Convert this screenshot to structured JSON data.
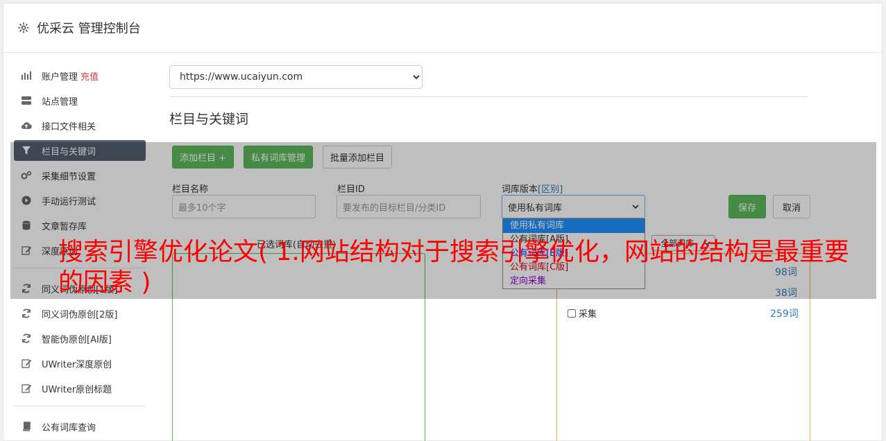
{
  "header": {
    "title": "优采云 管理控制台"
  },
  "sidebar": {
    "items": [
      {
        "label": "账户管理",
        "extra": "充值"
      },
      {
        "label": "站点管理"
      },
      {
        "label": "接口文件相关"
      },
      {
        "label": "栏目与关键词"
      },
      {
        "label": "采集细节设置"
      },
      {
        "label": "手动运行测试"
      },
      {
        "label": "文章暂存库"
      },
      {
        "label": "深度原创"
      },
      {
        "label": "同义词伪原创[1版]"
      },
      {
        "label": "同义词伪原创[2版]"
      },
      {
        "label": "智能伪原创[AI版]"
      },
      {
        "label": "UWriter深度原创"
      },
      {
        "label": "UWriter原创标题"
      },
      {
        "label": "公有词库查询"
      }
    ]
  },
  "main": {
    "site_select": "https://www.ucaiyun.com",
    "section_title": "栏目与关键词",
    "buttons": {
      "add_column": "添加栏目 +",
      "private_lib": "私有词库管理",
      "batch_add": "批量添加栏目"
    },
    "form": {
      "name_label": "栏目名称",
      "name_placeholder": "最多10个字",
      "id_label": "栏目ID",
      "id_placeholder": "要发布的目标栏目/分类ID",
      "version_label": "词库版本",
      "version_label_extra": "[区别]",
      "version_value": "使用私有词库",
      "save": "保存",
      "cancel": "取消"
    },
    "dropdown_options": [
      "使用私有词库",
      "公有词库[A版]",
      "公有词库[B版]",
      "公有词库[C版]",
      "定向采集"
    ],
    "selected_label": "已选词库(自动去重)",
    "filter_select": "全部词库",
    "libraries": [
      {
        "name": "",
        "count": "98词"
      },
      {
        "name": "",
        "count": "38词"
      },
      {
        "name": "采集",
        "count": "259词"
      }
    ]
  },
  "banner": "搜索引擎优化论文( 1.网站结构对于搜索引擎优化，网站的结构是最重要的因素 )"
}
